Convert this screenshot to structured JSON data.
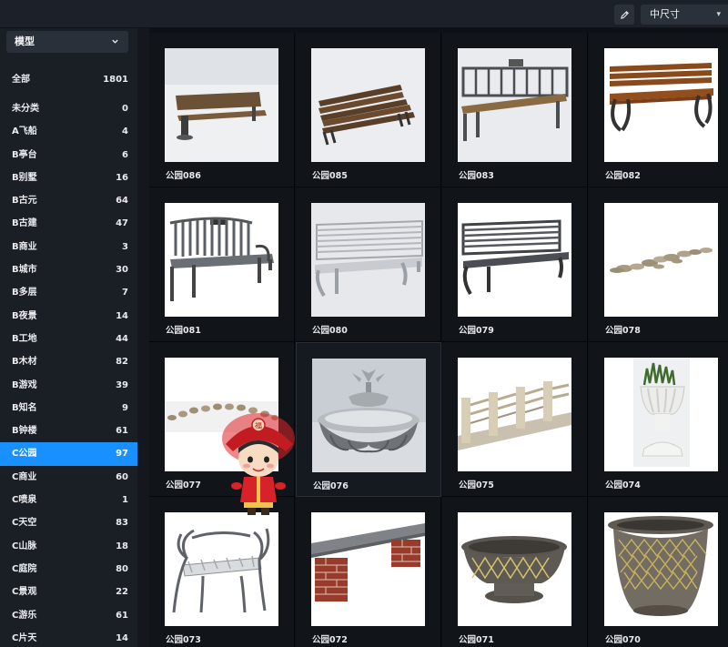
{
  "toolbar": {
    "size_select": "中尺寸",
    "edit_icon": "pencil-icon"
  },
  "sidebar": {
    "type_select": "模型",
    "categories": [
      {
        "label": "全部",
        "count": "1801"
      },
      {
        "label": "未分类",
        "count": "0"
      },
      {
        "label": "A飞船",
        "count": "4"
      },
      {
        "label": "B亭台",
        "count": "6"
      },
      {
        "label": "B别墅",
        "count": "16"
      },
      {
        "label": "B古元",
        "count": "64"
      },
      {
        "label": "B古建",
        "count": "47"
      },
      {
        "label": "B商业",
        "count": "3"
      },
      {
        "label": "B城市",
        "count": "30"
      },
      {
        "label": "B多层",
        "count": "7"
      },
      {
        "label": "B夜景",
        "count": "14"
      },
      {
        "label": "B工地",
        "count": "44"
      },
      {
        "label": "B木材",
        "count": "82"
      },
      {
        "label": "B游戏",
        "count": "39"
      },
      {
        "label": "B知名",
        "count": "9"
      },
      {
        "label": "B钟楼",
        "count": "61"
      },
      {
        "label": "C公园",
        "count": "97"
      },
      {
        "label": "C商业",
        "count": "60"
      },
      {
        "label": "C喷泉",
        "count": "1"
      },
      {
        "label": "C天空",
        "count": "83"
      },
      {
        "label": "C山脉",
        "count": "18"
      },
      {
        "label": "C庭院",
        "count": "80"
      },
      {
        "label": "C景观",
        "count": "22"
      },
      {
        "label": "C游乐",
        "count": "61"
      },
      {
        "label": "C片天",
        "count": "14"
      }
    ],
    "active_index": 16
  },
  "grid": {
    "items": [
      {
        "label": "公园086",
        "thumb": "park-bench-wood-single-leg"
      },
      {
        "label": "公园085",
        "thumb": "park-bench-wood-slats"
      },
      {
        "label": "公园083",
        "thumb": "park-bench-metal-wood"
      },
      {
        "label": "公园082",
        "thumb": "park-bench-ornate-iron"
      },
      {
        "label": "公园081",
        "thumb": "park-bench-metal-bars"
      },
      {
        "label": "公园080",
        "thumb": "park-bench-silver-bars"
      },
      {
        "label": "公园079",
        "thumb": "park-bench-dark-metal"
      },
      {
        "label": "公园078",
        "thumb": "stepping-stones-path"
      },
      {
        "label": "公园077",
        "thumb": "stone-row"
      },
      {
        "label": "公园076",
        "thumb": "lotus-fountain"
      },
      {
        "label": "公园075",
        "thumb": "stone-bridge-railing"
      },
      {
        "label": "公园074",
        "thumb": "grass-planter-pedestal"
      },
      {
        "label": "公园073",
        "thumb": "branch-bench"
      },
      {
        "label": "公园072",
        "thumb": "brick-stone-bench"
      },
      {
        "label": "公园071",
        "thumb": "bowl-planter"
      },
      {
        "label": "公园070",
        "thumb": "round-planter-pot"
      }
    ]
  },
  "overlay": {
    "mascot_icon": "chinese-doll-mascot-icon"
  },
  "colors": {
    "accent": "#1890ff",
    "sidebar_bg": "#1a1e25",
    "content_bg": "#111419"
  }
}
